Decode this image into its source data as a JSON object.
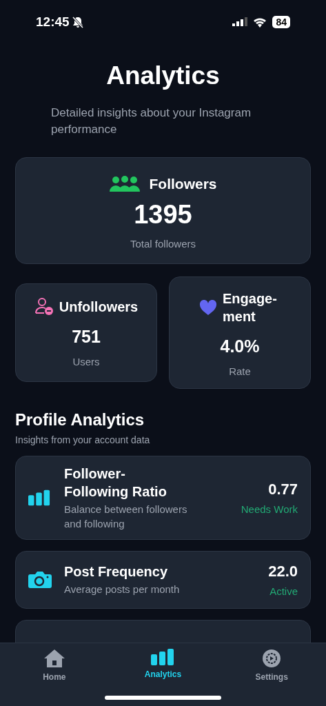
{
  "status_bar": {
    "time": "12:45",
    "battery": "84"
  },
  "header": {
    "title": "Analytics",
    "subtitle": "Detailed insights about your Instagram performance"
  },
  "followers_card": {
    "kind": "users",
    "color": "#22c55e",
    "label": "Followers",
    "value": "1395",
    "caption": "Total followers"
  },
  "stat_cards": [
    {
      "kind": "user-minus",
      "color": "#f472b6",
      "label": "Unfollowers",
      "value": "751",
      "caption": "Users"
    },
    {
      "kind": "heart",
      "color": "#6366f1",
      "label": "Engage-ment",
      "value": "4.0%",
      "caption": "Rate"
    }
  ],
  "profile_analytics": {
    "title": "Profile Analytics",
    "subtitle": "Insights from your account data",
    "metrics": [
      {
        "kind": "bars",
        "title": "Follower-Following Ratio",
        "description": "Balance between followers and following",
        "value": "0.77",
        "status": "Needs Work"
      },
      {
        "kind": "camera",
        "title": "Post Frequency",
        "description": "Average posts per month",
        "value": "22.0",
        "status": "Active"
      }
    ]
  },
  "tab_bar": [
    {
      "kind": "home",
      "label": "Home",
      "selected": false
    },
    {
      "kind": "bars",
      "label": "Analytics",
      "selected": true
    },
    {
      "kind": "settings",
      "label": "Settings",
      "selected": false
    }
  ]
}
